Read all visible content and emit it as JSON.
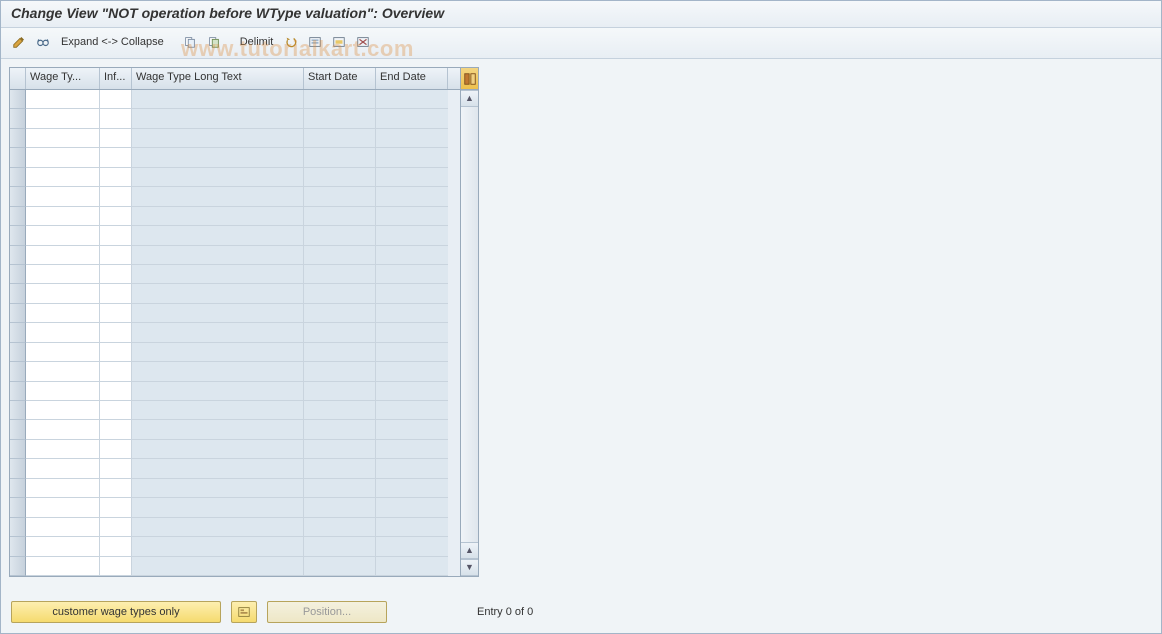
{
  "titlebar": {
    "title": "Change View \"NOT operation before WType valuation\": Overview"
  },
  "toolbar": {
    "expand_collapse_label": "Expand <-> Collapse",
    "delimit_label": "Delimit",
    "icons": {
      "display_change": "display-change-icon",
      "other_entry": "glasses-icon",
      "copy": "copy-icon",
      "copy2": "copy2-icon",
      "undo": "undo-icon",
      "select_all": "select-all-icon",
      "select_block": "select-block-icon",
      "deselect_all": "deselect-all-icon"
    }
  },
  "table": {
    "headers": {
      "wage_type": "Wage Ty...",
      "inf": "Inf...",
      "long_text": "Wage Type Long Text",
      "start_date": "Start Date",
      "end_date": "End Date"
    },
    "row_count": 25,
    "config_icon": "table-settings-icon"
  },
  "bottombar": {
    "customer_label": "customer wage types only",
    "position_label": "Position...",
    "entry_text": "Entry 0 of 0"
  },
  "watermark": "www.tutorialkart.com"
}
